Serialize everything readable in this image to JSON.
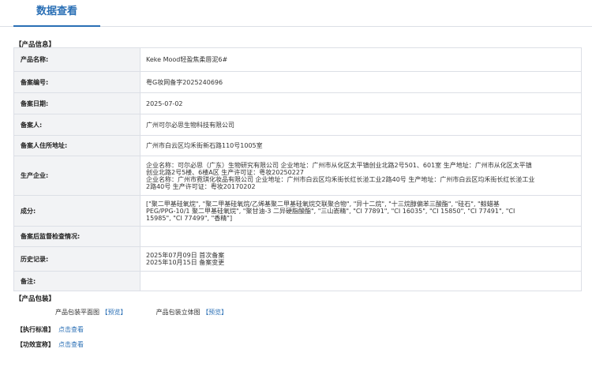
{
  "tab": {
    "label": "数据查看"
  },
  "product_info": {
    "section_title": "【产品信息】",
    "rows": [
      {
        "label": "产品名称:",
        "value": "Keke Mood轻盈焦柔唇泥6#"
      },
      {
        "label": "备案编号:",
        "value": "粤G妆网备字2025240696"
      },
      {
        "label": "备案日期:",
        "value": "2025-07-02"
      },
      {
        "label": "备案人:",
        "value": "广州可尔必思生物科技有限公司"
      },
      {
        "label": "备案人住所地址:",
        "value": "广州市白云区均禾街新石路110号1005室"
      },
      {
        "label": "生产企业:",
        "lines": [
          "企业名称：可尔必思（广东）生物研究有限公司 企业地址：广州市从化区太平镇创业北路2号501、601室 生产地址：广州市从化区太平镇",
          "创业北路2号5楼、6楼A区 生产许可证：粤妆20250227",
          "企业名称：广州市霓琪化妆品有限公司 企业地址：广州市白云区均禾街长红长湴工业2路40号 生产地址：广州市白云区均禾街长红长湴工业",
          "2路40号 生产许可证：粤妆20170202"
        ]
      },
      {
        "label": "成分:",
        "lines": [
          "[\"聚二甲基硅氧烷\", \"聚二甲基硅氧烷/乙烯基聚二甲基硅氧烷交联聚合物\", \"异十二烷\", \"十三烷醇偏苯三酸酯\", \"硅石\", \"鲸蜡基",
          "PEG/PPG-10/1 聚二甲基硅氧烷\", \"聚甘油-3 二异硬脂酸酯\", \"三山嵛精\", \"CI 77891\", \"CI 16035\", \"CI 15850\", \"CI 77491\", \"CI",
          "15985\", \"CI 77499\", \"香精\"]"
        ]
      },
      {
        "label": "备案后监督检查情况:",
        "value": ""
      },
      {
        "label": "历史记录:",
        "lines": [
          "2025年07月09日 首次备案",
          "2025年10月15日 备案变更"
        ]
      },
      {
        "label": "备注:",
        "value": ""
      }
    ]
  },
  "packaging": {
    "section_title": "【产品包装】",
    "flat_label": "产品包装平面图",
    "flat_link": "【预览】",
    "stereo_label": "产品包装立体图",
    "stereo_link": "【预览】"
  },
  "standard": {
    "label": "【执行标准】",
    "link": "点击查看"
  },
  "efficacy": {
    "label": "【功效宣称】",
    "link": "点击查看"
  }
}
